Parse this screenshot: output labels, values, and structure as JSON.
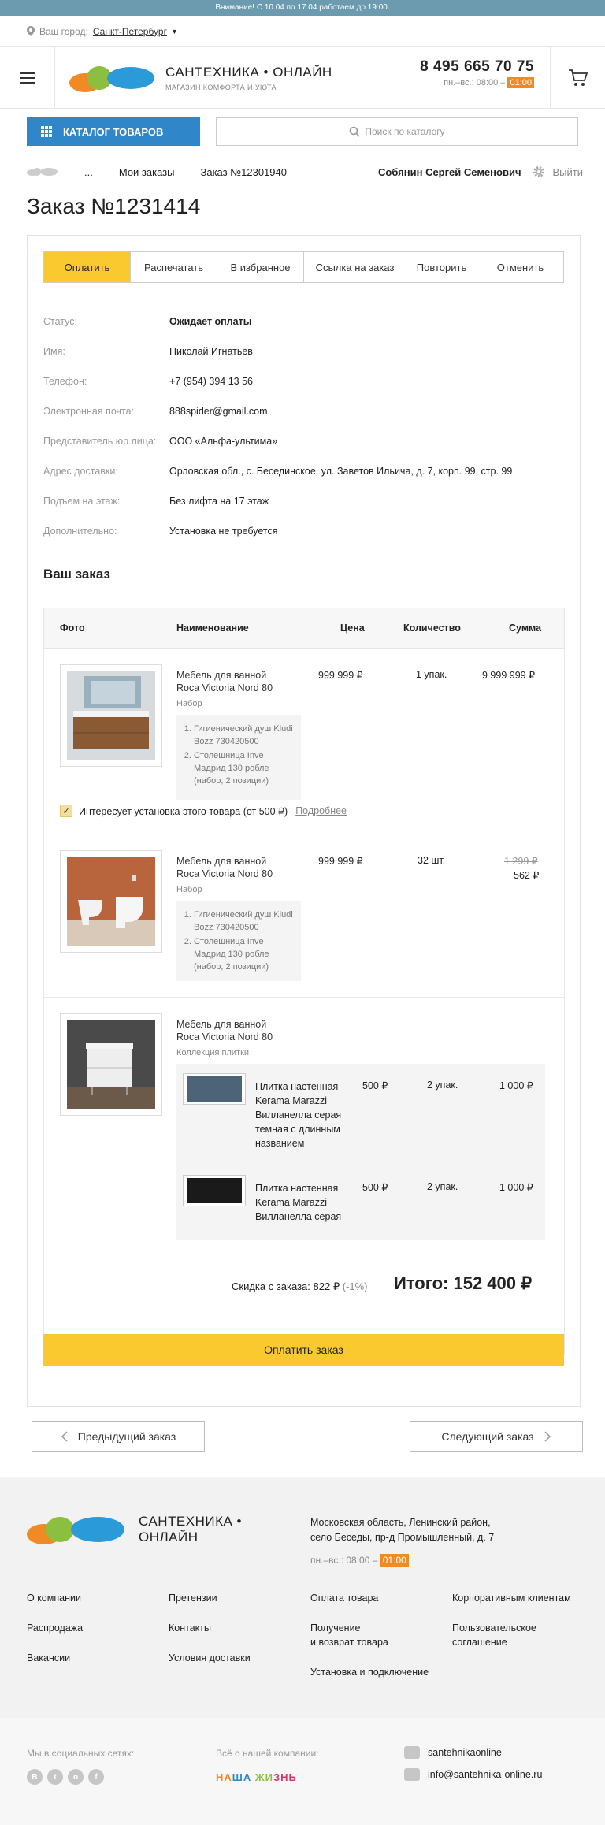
{
  "notice": "Внимание! С 10.04 по 17.04 работаем до 19:00.",
  "city": {
    "label": "Ваш город:",
    "value": "Санкт-Петербург"
  },
  "brand": {
    "name": "САНТЕХНИКА • ОНЛАЙН",
    "tagline": "МАГАЗИН КОМФОРТА И УЮТА",
    "footer_name_1": "САНТЕХНИКА •",
    "footer_name_2": "ОНЛАЙН"
  },
  "contacts": {
    "phone": "8 495 665 70 75",
    "hours_prefix": "пн.–вс.: 08:00 –",
    "hours_end": "01:00"
  },
  "nav": {
    "catalog": "КАТАЛОГ ТОВАРОВ",
    "search_placeholder": "Поиск по каталогу"
  },
  "breadcrumbs": {
    "ellipsis": "...",
    "my_orders": "Мои заказы",
    "current": "Заказ №12301940"
  },
  "user": {
    "name": "Собянин Сергей Семенович",
    "logout": "Выйти"
  },
  "page_title": "Заказ №1231414",
  "tabs": [
    "Оплатить",
    "Распечатать",
    "В избранное",
    "Ссылка на заказ",
    "Повторить",
    "Отменить"
  ],
  "info": [
    {
      "label": "Статус:",
      "value": "Ожидает оплаты"
    },
    {
      "label": "Имя:",
      "value": "Николай Игнатьев"
    },
    {
      "label": "Телефон:",
      "value": "+7 (954) 394 13 56"
    },
    {
      "label": "Электронная почта:",
      "value": "888spider@gmail.com"
    },
    {
      "label": "Представитель юр.лица:",
      "value": "ООО «Альфа-ультима»"
    },
    {
      "label": "Адрес доставки:",
      "value": "Орловская обл., с. Бесединское, ул. Заветов Ильича, д. 7, корп. 99, стр. 99"
    },
    {
      "label": "Подъем на этаж:",
      "value": "Без лифта на 17 этаж"
    },
    {
      "label": "Дополнительно:",
      "value": "Установка не требуется"
    }
  ],
  "order_section_title": "Ваш заказ",
  "columns": {
    "photo": "Фото",
    "name": "Наименование",
    "price": "Цена",
    "qty": "Количество",
    "sum": "Сумма"
  },
  "items": [
    {
      "name": "Мебель для ванной Roca Victoria Nord 80",
      "type": "Набор",
      "sub": [
        "Гигиенический душ Kludi Bozz 730420500",
        "Столешница Inve Мадрид 130 робле (набор, 2 позиции)"
      ],
      "price": "999 999 ₽",
      "qty": "1 упак.",
      "sum": "9 999 999 ₽",
      "install": "Интересует установка этого товара (от 500 ₽)",
      "install_more": "Подробнее"
    },
    {
      "name": "Мебель для ванной Roca Victoria Nord 80",
      "type": "Набор",
      "sub": [
        "Гигиенический душ Kludi Bozz 730420500",
        "Столешница Inve Мадрид 130 робле (набор, 2 позиции)"
      ],
      "price": "999 999 ₽",
      "qty": "32 шт.",
      "old_sum": "1 299 ₽",
      "sum": "562 ₽"
    },
    {
      "name": "Мебель для ванной Roca Victoria Nord 80",
      "type": "Коллекция плитки",
      "tiles": [
        {
          "name": "Плитка настенная Kerama Marazzi Вилланелла серая темная с длинным названием",
          "price": "500 ₽",
          "qty": "2 упак.",
          "sum": "1 000 ₽",
          "color": "#4d6478"
        },
        {
          "name": "Плитка настенная Kerama Marazzi Вилланелла серая",
          "price": "500 ₽",
          "qty": "2 упак.",
          "sum": "1 000 ₽",
          "color": "#1a1a1a"
        }
      ]
    }
  ],
  "totals": {
    "discount": "Скидка с заказа: 822 ₽",
    "discount_pct": "(-1%)",
    "grand": "Итого: 152 400 ₽"
  },
  "pay_button": "Оплатить заказ",
  "prev_order": "Предыдущий заказ",
  "next_order": "Следующий заказ",
  "footer": {
    "address_1": "Московская область, Ленинский район,",
    "address_2": "село Беседы, пр-д Промышленный, д. 7",
    "links": [
      "О компании",
      "Претензии",
      "Оплата товара",
      "Корпоративным клиентам",
      "Распродажа",
      "Контакты",
      "Получение",
      "и возврат товара",
      "Пользовательское",
      "соглашение",
      "Вакансии",
      "Условия доставки",
      "Установка и подключение"
    ],
    "social_label": "Мы в социальных сетях:",
    "about_label": "Всё о нашей компании:",
    "nz": "НАША ЖИЗНЬ",
    "skype": "santehnikaonline",
    "email": "info@santehnika-online.ru"
  },
  "accent_colors": {
    "blue": "#2f86c8",
    "yellow": "#f9c92f",
    "orange": "#f08a24"
  }
}
